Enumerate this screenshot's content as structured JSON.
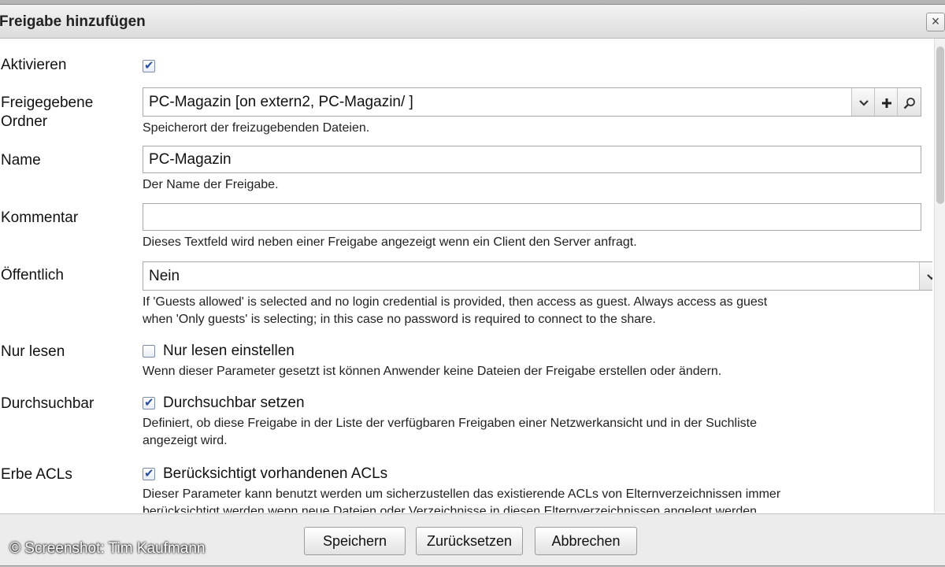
{
  "dialog": {
    "title": "Freigabe hinzufügen",
    "close_symbol": "×"
  },
  "fields": {
    "aktivieren": {
      "label": "Aktivieren",
      "checked": true
    },
    "ordner": {
      "label_line1": "Freigegebene",
      "label_line2": "Ordner",
      "value": "PC-Magazin [on extern2, PC-Magazin/ ]",
      "help": "Speicherort der freizugebenden Dateien."
    },
    "name": {
      "label": "Name",
      "value": "PC-Magazin",
      "help": "Der Name der Freigabe."
    },
    "kommentar": {
      "label": "Kommentar",
      "value": "",
      "help": "Dieses Textfeld wird neben einer Freigabe angezeigt wenn ein Client den Server anfragt."
    },
    "oeffentlich": {
      "label": "Öffentlich",
      "value": "Nein",
      "help_line1": "If 'Guests allowed' is selected and no login credential is provided, then access as guest. Always access as guest",
      "help_line2": "when 'Only guests' is selecting; in this case no password is required to connect to the share."
    },
    "nur_lesen": {
      "label": "Nur lesen",
      "checkbox_label": "Nur lesen einstellen",
      "checked": false,
      "help": "Wenn dieser Parameter gesetzt ist können Anwender keine Dateien der Freigabe erstellen oder ändern."
    },
    "durchsuchbar": {
      "label": "Durchsuchbar",
      "checkbox_label": "Durchsuchbar setzen",
      "checked": true,
      "help_line1": "Definiert, ob diese Freigabe in der Liste der verfügbaren Freigaben einer Netzwerkansicht und in der Suchliste",
      "help_line2": "angezeigt wird."
    },
    "erbe_acls": {
      "label": "Erbe ACLs",
      "checkbox_label": "Berücksichtigt vorhandenen ACLs",
      "checked": true,
      "help_line1": "Dieser Parameter kann benutzt werden um sicherzustellen das existierende ACLs von Elternverzeichnissen immer",
      "help_line2": "berücksichtigt werden wenn neue Dateien oder Verzeichnisse in diesen Elternverzeichnissen angelegt werden."
    }
  },
  "icons": {
    "dropdown": "chevron-down-icon",
    "add": "plus-icon",
    "search": "search-icon"
  },
  "buttons": {
    "save": "Speichern",
    "reset": "Zurücksetzen",
    "cancel": "Abbrechen"
  },
  "watermark": "© Screenshot: Tim Kaufmann"
}
